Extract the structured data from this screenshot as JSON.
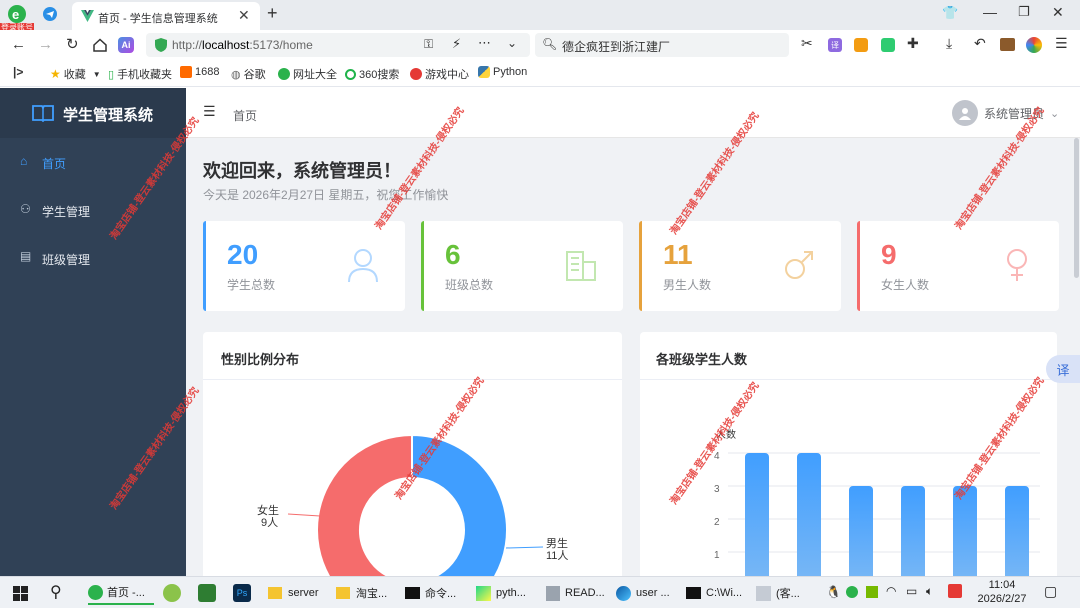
{
  "browser": {
    "badge": "登录账号",
    "tab_title": "首页 - 学生信息管理系统",
    "url_prefix": "http://",
    "url_host": "localhost",
    "url_rest": ":5173/home",
    "search_text": "德企疯狂到浙江建厂",
    "bookmarks": [
      "收藏",
      "手机收藏夹",
      "1688",
      "谷歌",
      "网址大全",
      "360搜索",
      "游戏中心",
      "Python"
    ]
  },
  "app": {
    "title": "学生管理系统",
    "menu": [
      "首页",
      "学生管理",
      "班级管理"
    ],
    "breadcrumb": "首页",
    "user": "系统管理员",
    "welcome": "欢迎回来，系统管理员！",
    "date_line": "今天是 2026年2月27日 星期五，祝您工作愉快"
  },
  "stats": [
    {
      "value": "20",
      "label": "学生总数",
      "color": "#409eff"
    },
    {
      "value": "6",
      "label": "班级总数",
      "color": "#67c23a"
    },
    {
      "value": "11",
      "label": "男生人数",
      "color": "#e6a23c"
    },
    {
      "value": "9",
      "label": "女生人数",
      "color": "#f56c6c"
    }
  ],
  "charts": {
    "gender_title": "性别比例分布",
    "class_title": "各班级学生人数",
    "female_label": "女生",
    "female_count": "9人",
    "male_label": "男生",
    "male_count": "11人",
    "y_axis_name": "人数",
    "y_ticks": [
      "4",
      "3",
      "2",
      "1"
    ]
  },
  "chart_data": [
    {
      "type": "pie",
      "title": "性别比例分布",
      "categories": [
        "女生",
        "男生"
      ],
      "values": [
        9,
        11
      ],
      "colors": [
        "#f56c6c",
        "#409eff"
      ]
    },
    {
      "type": "bar",
      "title": "各班级学生人数",
      "ylabel": "人数",
      "values": [
        4,
        4,
        3,
        3,
        3,
        3
      ],
      "ylim": [
        0,
        4
      ],
      "color": "#409eff"
    }
  ],
  "float_button": "译",
  "watermark": "淘宝店铺-登云素材科技-侵权必究",
  "taskbar": {
    "items": [
      "首页 -...",
      "server",
      "淘宝...",
      "命令...",
      "pyth...",
      "READ...",
      "user ...",
      "C:\\Wi...",
      "(客..."
    ],
    "time": "11:04",
    "date": "2026/2/27"
  }
}
